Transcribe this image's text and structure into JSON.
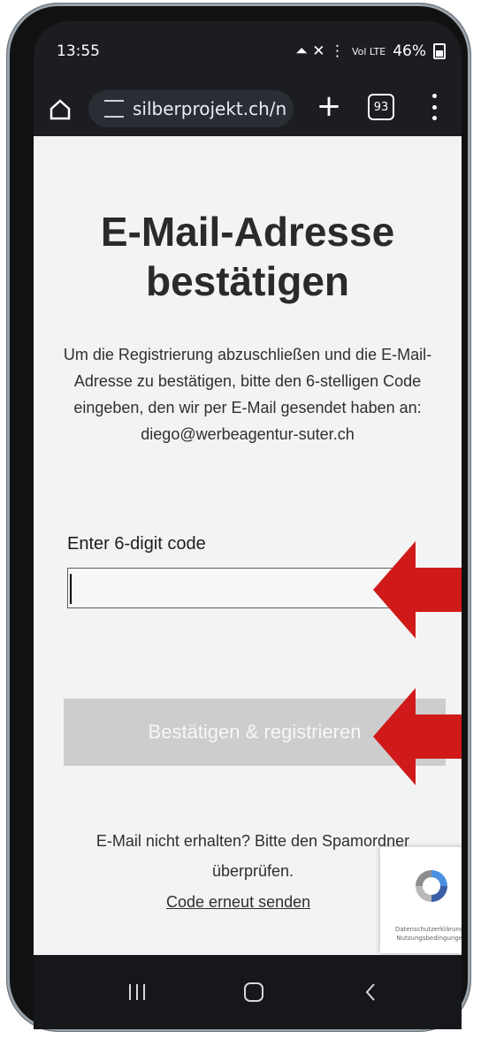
{
  "status": {
    "time": "13:55",
    "indicators": "⏶ ✕ ⋮",
    "small": "Vol LTE",
    "battery": "46%"
  },
  "browser": {
    "url": "silberprojekt.ch/n",
    "tabs_count": "93"
  },
  "page": {
    "title": "E-Mail-Adresse bestätigen",
    "description": "Um die Registrierung abzuschließen und die E-Mail-Adresse zu bestätigen, bitte den 6-stelligen Code eingeben, den wir per E-Mail gesendet haben an: diego@werbeagentur-suter.ch",
    "code_label": "Enter 6-digit code",
    "code_value": "",
    "submit_label": "Bestätigen & registrieren",
    "help_text": "E-Mail nicht erhalten? Bitte den Spamordner überprüfen.",
    "resend_label": "Code erneut senden"
  },
  "recaptcha": {
    "legal": "Datenschutzerklärung - Nutzungsbedingungen"
  },
  "colors": {
    "arrow": "#d01a1a",
    "button_bg": "#cdcdcd",
    "page_bg": "#f3f3f3"
  }
}
